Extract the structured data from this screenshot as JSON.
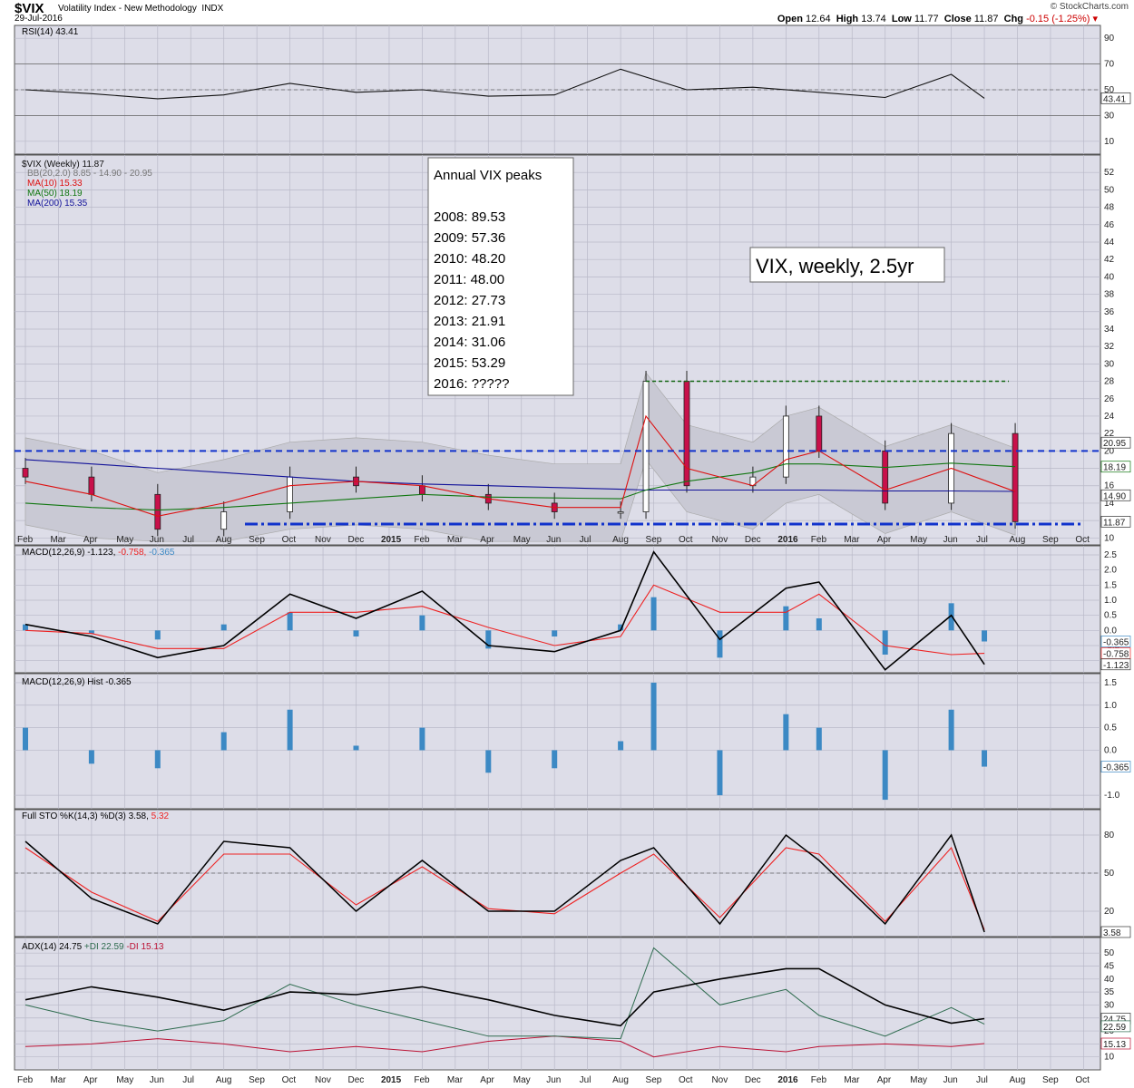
{
  "header": {
    "symbol": "$VIX",
    "description": "Volatility Index - New Methodology",
    "exchange": "INDX",
    "date": "29-Jul-2016",
    "open_label": "Open",
    "open": "12.64",
    "high_label": "High",
    "high": "13.74",
    "low_label": "Low",
    "low": "11.77",
    "close_label": "Close",
    "close": "11.87",
    "chg_label": "Chg",
    "chg": "-0.15 (-1.25%)",
    "brand": "© StockCharts.com"
  },
  "colors": {
    "panel_bg": "#dddde8",
    "up_candle": "#ffffff",
    "down_candle": "#c8104a",
    "ma10": "#dd1111",
    "ma50": "#117711",
    "ma200": "#111199",
    "bb_fill": "#c9c9d4",
    "macd_hist": "#3c89c4",
    "signal": "#ee2222",
    "annot_blue": "#1133cc",
    "annot_red": "#ee1111"
  },
  "time_axis": [
    "Feb",
    "Mar",
    "Apr",
    "May",
    "Jun",
    "Jul",
    "Aug",
    "Sep",
    "Oct",
    "Nov",
    "Dec",
    "2015",
    "Feb",
    "Mar",
    "Apr",
    "May",
    "Jun",
    "Jul",
    "Aug",
    "Sep",
    "Oct",
    "Nov",
    "Dec",
    "2016",
    "Feb",
    "Mar",
    "Apr",
    "May",
    "Jun",
    "Jul",
    "Aug",
    "Sep",
    "Oct"
  ],
  "panels": {
    "rsi": {
      "title": "RSI(14) 43.41",
      "ticks": [
        "90",
        "70",
        "50",
        "30",
        "10"
      ],
      "last_value": "43.41"
    },
    "price": {
      "title": "$VIX (Weekly) 11.87",
      "bb": "BB(20,2.0) 8.85 - 14.90 - 20.95",
      "ma10": "MA(10) 15.33",
      "ma50": "MA(50) 18.19",
      "ma200": "MA(200) 15.35",
      "ticks": [
        "52",
        "50",
        "48",
        "46",
        "44",
        "42",
        "40",
        "38",
        "36",
        "34",
        "32",
        "30",
        "28",
        "26",
        "24",
        "22",
        "20",
        "18",
        "16",
        "14",
        "12",
        "10"
      ],
      "right_labels": [
        "20.95",
        "18.19",
        "14.90",
        "11.87"
      ],
      "peaks_box": [
        "Annual VIX peaks",
        "",
        "2008: 89.53",
        "2009: 57.36",
        "2010: 48.20",
        "2011: 48.00",
        "2012: 27.73",
        "2013: 21.91",
        "2014: 31.06",
        "2015: 53.29",
        "2016: ?????"
      ],
      "note": "VIX, weekly, 2.5yr"
    },
    "macd": {
      "title_prefix": "MACD(12,26,9) -1.123,",
      "title_signal": " -0.758,",
      "title_hist": " -0.365",
      "ticks": [
        "2.5",
        "2.0",
        "1.5",
        "1.0",
        "0.5",
        "0.0",
        "-0.5",
        "-1.0"
      ],
      "right_labels": [
        "-0.365",
        "-0.758",
        "-1.123"
      ]
    },
    "hist": {
      "title": "MACD(12,26,9) Hist -0.365",
      "ticks": [
        "1.5",
        "1.0",
        "0.5",
        "0.0",
        "-1.0"
      ],
      "right_labels": [
        "-0.365"
      ]
    },
    "sto": {
      "title_prefix": "Full STO %K(14,3) %D(3) 3.58,",
      "title_d": " 5.32",
      "ticks": [
        "80",
        "50",
        "20"
      ],
      "right_labels": [
        "3.58"
      ]
    },
    "adx": {
      "title_prefix": "ADX(14) 24.75",
      "title_plus": " +DI 22.59",
      "title_minus": " -DI 15.13",
      "ticks": [
        "50",
        "45",
        "40",
        "35",
        "30",
        "25",
        "20",
        "15",
        "10"
      ],
      "right_labels": [
        "24.75",
        "22.59",
        "15.13"
      ]
    }
  },
  "chart_data": [
    {
      "type": "line",
      "name": "RSI(14)",
      "x": [
        "2014-02",
        "2014-04",
        "2014-06",
        "2014-08",
        "2014-10",
        "2014-12",
        "2015-02",
        "2015-04",
        "2015-06",
        "2015-08",
        "2015-10",
        "2015-12",
        "2016-02",
        "2016-04",
        "2016-06",
        "2016-07"
      ],
      "series": [
        {
          "name": "RSI(14)",
          "values": [
            50,
            47,
            43,
            46,
            55,
            48,
            50,
            45,
            46,
            66,
            50,
            52,
            48,
            44,
            62,
            43.41
          ]
        }
      ],
      "ylim": [
        0,
        100
      ]
    },
    {
      "type": "candlestick",
      "title": "$VIX (Weekly) 11.87",
      "x": [
        "2014-02",
        "2014-04",
        "2014-06",
        "2014-08",
        "2014-10",
        "2014-12",
        "2015-02",
        "2015-04",
        "2015-06",
        "2015-08",
        "2015-08-24",
        "2015-10",
        "2015-12",
        "2016-01",
        "2016-02",
        "2016-04",
        "2016-06",
        "2016-07-29"
      ],
      "series": [
        {
          "name": "Close",
          "values": [
            17,
            15,
            11,
            13,
            17,
            16,
            15,
            14,
            13,
            13,
            28,
            16,
            17,
            24,
            20,
            14,
            22,
            11.87
          ]
        },
        {
          "name": "MA(10)",
          "values": [
            16.5,
            15,
            12.5,
            14,
            16,
            16.5,
            16,
            14.5,
            13.5,
            13.5,
            24,
            18,
            16,
            19,
            20,
            15.5,
            18,
            15.33
          ]
        },
        {
          "name": "MA(50)",
          "values": [
            14,
            13.5,
            13.2,
            13.5,
            14,
            14.5,
            15,
            14.7,
            14.6,
            14.5,
            15.5,
            16.5,
            17.5,
            18.5,
            18.5,
            18.1,
            18.6,
            18.19
          ]
        },
        {
          "name": "MA(200)",
          "values": [
            19,
            18.5,
            18,
            17.5,
            17,
            16.5,
            16.2,
            16,
            15.8,
            15.6,
            15.5,
            15.5,
            15.5,
            15.5,
            15.5,
            15.4,
            15.4,
            15.35
          ]
        }
      ],
      "annual_peaks": {
        "2008": 89.53,
        "2009": 57.36,
        "2010": 48.2,
        "2011": 48.0,
        "2012": 27.73,
        "2013": 21.91,
        "2014": 31.06,
        "2015": 53.29
      },
      "ylim": [
        10,
        53
      ]
    },
    {
      "type": "line",
      "name": "MACD(12,26,9)",
      "x": [
        "2014-02",
        "2014-04",
        "2014-06",
        "2014-08",
        "2014-10",
        "2014-12",
        "2015-02",
        "2015-04",
        "2015-06",
        "2015-08",
        "2015-09",
        "2015-11",
        "2016-01",
        "2016-02",
        "2016-04",
        "2016-06",
        "2016-07"
      ],
      "series": [
        {
          "name": "MACD",
          "values": [
            0.2,
            -0.2,
            -0.9,
            -0.5,
            1.2,
            0.4,
            1.3,
            -0.5,
            -0.7,
            0.0,
            2.6,
            -0.3,
            1.4,
            1.6,
            -1.3,
            0.5,
            -1.123
          ]
        },
        {
          "name": "Signal",
          "values": [
            0.0,
            -0.1,
            -0.6,
            -0.6,
            0.6,
            0.6,
            0.8,
            0.1,
            -0.5,
            -0.2,
            1.5,
            0.6,
            0.6,
            1.2,
            -0.5,
            -0.8,
            -0.758
          ]
        },
        {
          "name": "Hist",
          "values": [
            0.2,
            -0.1,
            -0.3,
            0.2,
            0.6,
            -0.2,
            0.5,
            -0.6,
            -0.2,
            0.2,
            1.1,
            -0.9,
            0.8,
            0.4,
            -0.8,
            0.9,
            -0.365
          ]
        }
      ],
      "ylim": [
        -1.4,
        2.8
      ]
    },
    {
      "type": "bar",
      "name": "MACD(12,26,9) Hist",
      "x": [
        "2014-02",
        "2014-04",
        "2014-06",
        "2014-08",
        "2014-10",
        "2014-12",
        "2015-02",
        "2015-04",
        "2015-06",
        "2015-08",
        "2015-09",
        "2015-11",
        "2016-01",
        "2016-02",
        "2016-04",
        "2016-06",
        "2016-07"
      ],
      "values": [
        0.5,
        -0.3,
        -0.4,
        0.4,
        0.9,
        0.1,
        0.5,
        -0.5,
        -0.4,
        0.2,
        1.5,
        -1.0,
        0.8,
        0.5,
        -1.1,
        0.9,
        -0.365
      ],
      "ylim": [
        -1.3,
        1.7
      ]
    },
    {
      "type": "line",
      "name": "Full STO %K(14,3) %D(3)",
      "x": [
        "2014-02",
        "2014-04",
        "2014-06",
        "2014-08",
        "2014-10",
        "2014-12",
        "2015-02",
        "2015-04",
        "2015-06",
        "2015-08",
        "2015-09",
        "2015-11",
        "2016-01",
        "2016-02",
        "2016-04",
        "2016-06",
        "2016-07"
      ],
      "series": [
        {
          "name": "%K",
          "values": [
            75,
            30,
            10,
            75,
            70,
            20,
            60,
            20,
            20,
            60,
            70,
            10,
            80,
            60,
            10,
            80,
            3.58
          ]
        },
        {
          "name": "%D",
          "values": [
            70,
            35,
            12,
            65,
            65,
            25,
            55,
            22,
            18,
            50,
            65,
            15,
            70,
            65,
            12,
            70,
            5.32
          ]
        }
      ],
      "ylim": [
        0,
        100
      ]
    },
    {
      "type": "line",
      "name": "ADX(14)",
      "x": [
        "2014-02",
        "2014-04",
        "2014-06",
        "2014-08",
        "2014-10",
        "2014-12",
        "2015-02",
        "2015-04",
        "2015-06",
        "2015-08",
        "2015-09",
        "2015-11",
        "2016-01",
        "2016-02",
        "2016-04",
        "2016-06",
        "2016-07"
      ],
      "series": [
        {
          "name": "ADX",
          "values": [
            32,
            37,
            33,
            28,
            35,
            34,
            37,
            32,
            26,
            22,
            35,
            40,
            44,
            44,
            30,
            23,
            24.75
          ]
        },
        {
          "name": "+DI",
          "values": [
            30,
            24,
            20,
            24,
            38,
            30,
            24,
            18,
            18,
            17,
            52,
            30,
            36,
            26,
            18,
            29,
            22.59
          ]
        },
        {
          "name": "-DI",
          "values": [
            14,
            15,
            17,
            15,
            12,
            14,
            12,
            16,
            18,
            16,
            10,
            14,
            12,
            14,
            15,
            14,
            15.13
          ]
        }
      ],
      "ylim": [
        5,
        56
      ]
    }
  ]
}
